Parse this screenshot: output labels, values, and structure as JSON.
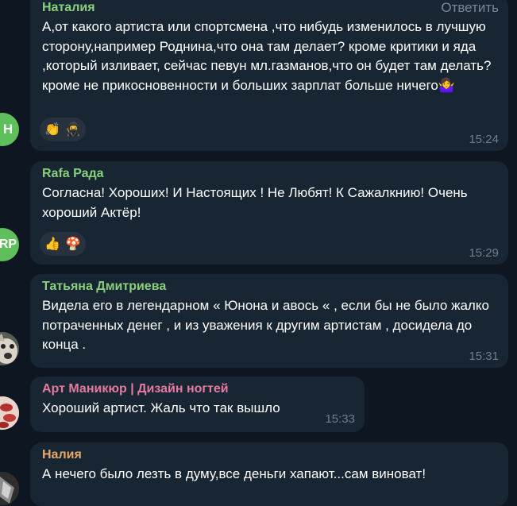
{
  "messages": [
    {
      "sender": "Наталия",
      "sender_color": "#8ad07c",
      "reply_label": "Ответить",
      "text": "А,от какого артиста или спортсмена ,что нибудь изменилось в лучшую сторону,например Роднина,что она там делает? кроме критики и яда ,который изливает, сейчас певун мл.газманов,что он будет там делать?кроме не прикосновенности и больших зарплат больше ничего🤷‍♀️",
      "reactions": [
        "👏",
        "🥷"
      ],
      "time": "15:24",
      "avatar": {
        "initials": "Н",
        "color": "#5fbf5a"
      }
    },
    {
      "sender": "Rafa Рада",
      "sender_color": "#8ad07c",
      "text": "Согласна! Хороших! И Настоящих ! Не Любят! К Сажалкнию! Очень хороший Актёр!",
      "reactions": [
        "👍",
        "🍄"
      ],
      "time": "15:29",
      "avatar": {
        "initials": "RP",
        "color": "#5fbf5a"
      }
    },
    {
      "sender": "Татьяна Дмитриева",
      "sender_color": "#8ad07c",
      "text": "Видела его в легендарном « Юнона и авось « , если бы не было жалко потраченных денег , и из уважения к другим артистам , досидела до конца .",
      "time": "15:31",
      "avatar": {
        "kind": "photo-dog"
      }
    },
    {
      "sender": "Арт Маникюр | Дизайн ногтей",
      "sender_color": "#e57ba0",
      "text": "Хороший артист. Жаль что так вышло",
      "time": "15:33",
      "avatar": {
        "kind": "photo-nails"
      }
    },
    {
      "sender": "Налия",
      "sender_color": "#e8a86a",
      "text": "А нечего было лезть в думу,все деньги хапают...сам виноват!",
      "avatar": {
        "kind": "photo-dark"
      }
    }
  ]
}
